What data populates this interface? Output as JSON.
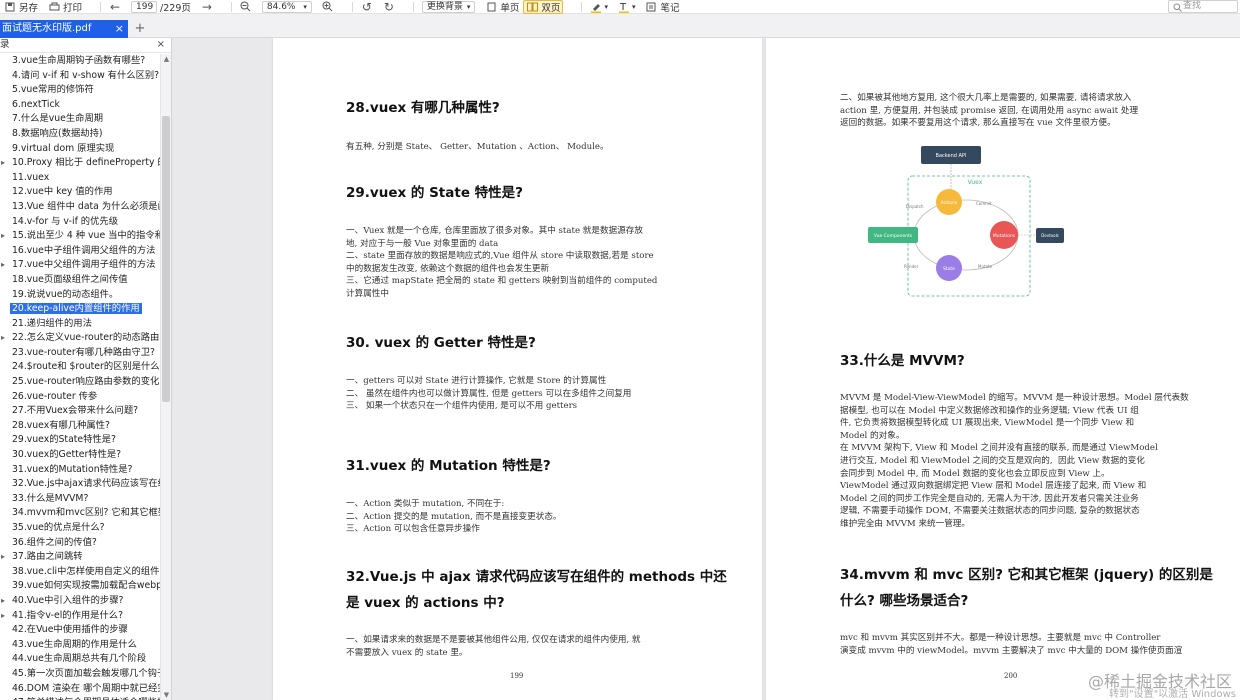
{
  "toolbar": {
    "save": "另存",
    "print": "打印",
    "page_current": "199",
    "page_total": "/229页",
    "zoom": "84.6%",
    "bg": "更换背景",
    "single": "单页",
    "double": "双页",
    "note": "笔记",
    "search_placeholder": "查找"
  },
  "tab": {
    "title": "面试题无水印版.pdf",
    "close": "×",
    "add": "+"
  },
  "sidebar": {
    "header": "录",
    "close": "×",
    "items": [
      "3.vue生命周期钩子函数有哪些?",
      "4.请问 v-if 和 v-show 有什么区别?",
      "5.vue常用的修饰符",
      "6.nextTick",
      "7.什么是vue生命周期",
      "8.数据响应(数据劫持)",
      "9.virtual dom 原理实现",
      "10.Proxy 相比于 defineProperty 的优",
      "11.vuex",
      "12.vue中 key 值的作用",
      "13.Vue 组件中 data 为什么必须是函数",
      "14.v-for 与 v-if 的优先级",
      "15.说出至少 4 种 vue 当中的指令和它",
      "16.vue中子组件调用父组件的方法",
      "17.vue中父组件调用子组件的方法",
      "18.vue页面级组件之间传值",
      "19.说说vue的动态组件。",
      "20.keep-alive内置组件的作用",
      "21.递归组件的用法",
      "22.怎么定义vue-router的动态路由? ",
      "23.vue-router有哪几种路由守卫?",
      "24.$route和 $router的区别是什么?",
      "25.vue-router响应路由参数的变化",
      "26.vue-router 传参",
      "27.不用Vuex会带来什么问题?",
      "28.vuex有哪几种属性?",
      "29.vuex的State特性是?",
      "30.vuex的Getter特性是?",
      "31.vuex的Mutation特性是?",
      "32.Vue.js中ajax请求代码应该写在组件",
      "33.什么是MVVM?",
      "34.mvvm和mvc区别? 它和其它框架",
      "35.vue的优点是什么?",
      "36.组件之间的传值?",
      "37.路由之间跳转",
      "38.vue.cli中怎样使用自定义的组件? ",
      "39.vue如何实现按需加载配合webpac",
      "40.Vue中引入组件的步骤?",
      "41.指令v-el的作用是什么?",
      "42.在Vue中使用插件的步骤",
      "43.vue生命周期的作用是什么",
      "44.vue生命周期总共有几个阶段",
      "45.第一次页面加载会触发哪几个钩子",
      "46.DOM 渲染在 哪个周期中就已经完",
      "47.简单描述每个周期具体适合哪些场"
    ],
    "active_index": 17,
    "expandable": [
      7,
      12,
      14,
      19,
      34,
      37,
      38,
      45,
      46
    ]
  },
  "left_page": {
    "h28": "28.vuex 有哪几种属性?",
    "p28": "有五种, 分别是 State、 Getter、Mutation 、Action、 Module。",
    "h29": "29.vuex 的 State 特性是?",
    "p29": "一、Vuex 就是一个仓库, 仓库里面放了很多对象。其中 state 就是数据源存放\n地, 对应于与一般 Vue 对象里面的 data\n二、state 里面存放的数据是响应式的,Vue 组件从 store 中读取数据,若是 store\n中的数据发生改变, 依赖这个数据的组件也会发生更新\n三、它通过 mapState 把全局的 state 和 getters 映射到当前组件的 computed\n计算属性中",
    "h30": "30.    vuex 的 Getter 特性是?",
    "p30": "一、getters 可以对 State 进行计算操作, 它就是 Store 的计算属性\n二、 虽然在组件内也可以做计算属性, 但是 getters 可以在多组件之间复用\n三、 如果一个状态只在一个组件内使用, 是可以不用 getters",
    "h31": "31.vuex 的 Mutation 特性是?",
    "p31": "一、Action 类似于 mutation, 不同在于:\n二、Action 提交的是 mutation, 而不是直接变更状态。\n三、Action 可以包含任意异步操作",
    "h32a": "32.Vue.js 中 ajax 请求代码应该写在组件的 methods 中还",
    "h32b": "是 vuex 的 actions 中?",
    "p32": "一、如果请求来的数据是不是要被其他组件公用, 仅仅在请求的组件内使用, 就\n不需要放入 vuex 的 state 里。",
    "page_number": "199"
  },
  "right_page": {
    "p_top": "二、如果被其他地方复用, 这个很大几率上是需要的, 如果需要, 请将请求放入\naction 里, 方便复用, 并包装成 promise 返回, 在调用处用 async await 处理\n返回的数据。如果不要复用这个请求, 那么直接写在 vue 文件里很方便。",
    "h33": "33.什么是 MVVM?",
    "p33": "MVVM 是 Model-View-ViewModel 的缩写。MVVM 是一种设计思想。Model 层代表数\n据模型, 也可以在 Model 中定义数据修改和操作的业务逻辑; View 代表 UI 组\n件, 它负责将数据模型转化成 UI 展现出来, ViewModel 是一个同步 View 和\nModel 的对象。\n在 MVVM 架构下, View 和 Model 之间并没有直接的联系, 而是通过 ViewModel\n进行交互, Model 和 ViewModel 之间的交互是双向的,  因此 View 数据的变化\n会同步到 Model 中, 而 Model 数据的变化也会立即反应到 View 上。\nViewModel 通过双向数据绑定把 View 层和 Model 层连接了起来, 而 View 和\nModel 之间的同步工作完全是自动的, 无需人为干涉, 因此开发者只需关注业务\n逻辑, 不需要手动操作 DOM, 不需要关注数据状态的同步问题, 复杂的数据状态\n维护完全由 MVVM 来统一管理。",
    "h34a": "34.mvvm 和 mvc 区别? 它和其它框架 (jquery) 的区别是",
    "h34b": "什么? 哪些场景适合?",
    "p34": "mvc 和 mvvm 其实区别并不大。都是一种设计思想。主要就是 mvc 中 Controller\n演变成 mvvm 中的 viewModel。mvvm 主要解决了 mvc 中大量的 DOM 操作使页面渲",
    "page_number": "200",
    "diagram": {
      "top": "Backend API",
      "vuex": "Vuex",
      "vue_components": "Vue Components",
      "actions": "Actions",
      "mutations": "Mutations",
      "state": "State",
      "devtools": "Devtools",
      "dispatch": "Dispatch",
      "commit": "Commit",
      "mutate": "Mutate",
      "render": "Render"
    }
  },
  "watermark": {
    "main": "@稀土掘金技术社区",
    "sub": "转到\"设置\"以激活 Windows"
  },
  "colors": {
    "accent": "#2060e8",
    "active_item": "#2f6fe6",
    "actions": "#f6b93b",
    "mutations": "#e85656",
    "state": "#9b7de8",
    "vue": "#41b883",
    "backend": "#35495e"
  }
}
